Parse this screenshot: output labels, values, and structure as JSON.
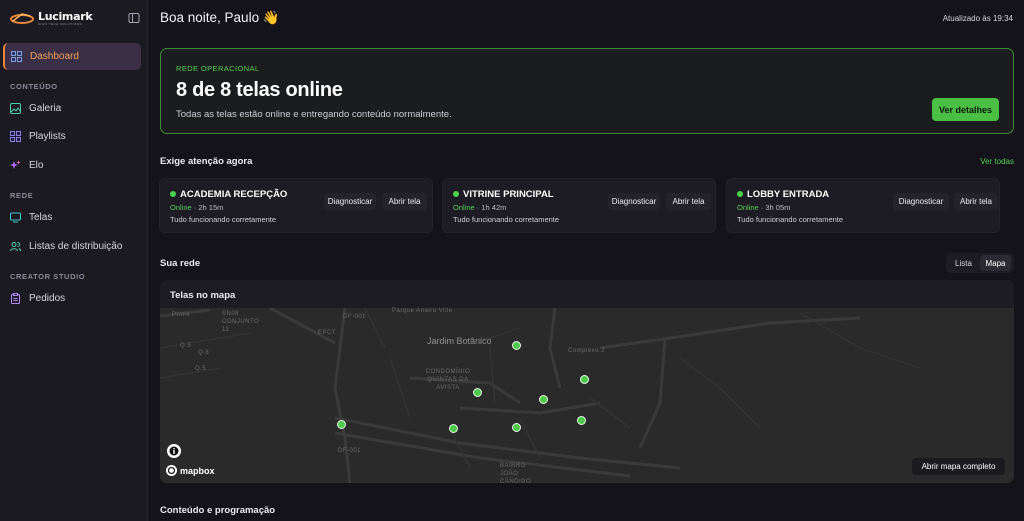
{
  "brand": {
    "name": "Lucimark",
    "tagline": "SIGN TECH SOLUTIONS",
    "accent": "#e8873a"
  },
  "sidebar": {
    "active": "Dashboard",
    "items": [
      {
        "label": "Dashboard",
        "icon": "dashboard-icon"
      },
      {
        "section": "CONTEÚDO"
      },
      {
        "label": "Galeria",
        "icon": "gallery-icon"
      },
      {
        "label": "Playlists",
        "icon": "playlists-icon"
      },
      {
        "label": "Elo",
        "icon": "sparkle-icon"
      },
      {
        "section": "REDE"
      },
      {
        "label": "Telas",
        "icon": "monitor-icon"
      },
      {
        "label": "Listas de distribuição",
        "icon": "users-icon"
      },
      {
        "section": "CREATOR STUDIO"
      },
      {
        "label": "Pedidos",
        "icon": "clipboard-icon"
      }
    ]
  },
  "header": {
    "greeting": "Boa noite, Paulo 👋",
    "updated": "Atualizado às 19:34"
  },
  "hero": {
    "kicker": "REDE OPERACIONAL",
    "title": "8 de 8 telas online",
    "description": "Todas as telas estão online e entregando conteúdo normalmente.",
    "button": "Ver detalhes",
    "status_color": "#4bbf43"
  },
  "attention": {
    "title": "Exige atenção agora",
    "see_all": "Ver todas",
    "cards": [
      {
        "name": "ACADEMIA RECEPÇÃO",
        "status": "Online",
        "uptime": "2h 15m",
        "message": "Tudo funcionando corretamente",
        "diagnose": "Diagnosticar",
        "open": "Abrir tela"
      },
      {
        "name": "VITRINE PRINCIPAL",
        "status": "Online",
        "uptime": "1h 42m",
        "message": "Tudo funcionando corretamente",
        "diagnose": "Diagnosticar",
        "open": "Abrir tela"
      },
      {
        "name": "LOBBY ENTRADA",
        "status": "Online",
        "uptime": "3h 05m",
        "message": "Tudo funcionando corretamente",
        "diagnose": "Diagnosticar",
        "open": "Abrir tela"
      }
    ]
  },
  "network": {
    "title": "Sua rede",
    "view_options": [
      "Lista",
      "Mapa"
    ],
    "selected_view": "Mapa",
    "map_title": "Telas no mapa",
    "map_labels": {
      "jardim": "Jardim Botânico",
      "condominio": "CONDOMÍNIO QUINTAS DA AVISTA",
      "bairro": "BAIRRO JOÃO CÂNDIDO",
      "parque": "Parque Anairo Ville",
      "prime": "Prime",
      "sn": "SN08 CONJUNTO 11",
      "epct": "EPCT",
      "df001": "DF-001",
      "df001b": "DF-001",
      "complexo": "Complexo 2",
      "q1": "Q.5",
      "q2": "Q.6",
      "q3": "Q.5"
    },
    "attribution": "mapbox",
    "full_map_button": "Abrir mapa completo"
  },
  "content_section": {
    "title": "Conteúdo e programação"
  }
}
